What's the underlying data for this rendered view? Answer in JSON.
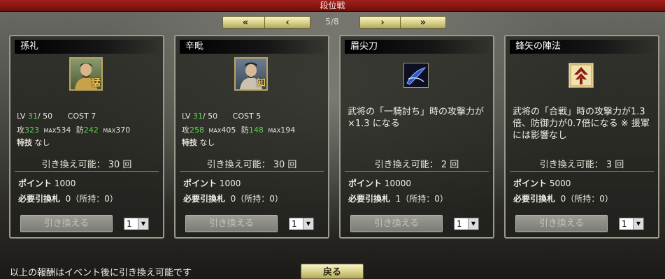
{
  "window": {
    "title": "段位戦"
  },
  "pager": {
    "first_label": "«",
    "prev_label": "‹",
    "next_label": "›",
    "last_label": "»",
    "indicator": "5/8"
  },
  "cards": [
    {
      "title": "孫礼",
      "kind": "general",
      "badge": "猛",
      "lv_label": "LV",
      "lv": "31",
      "lv_max": "/ 50",
      "cost_label": "COST",
      "cost": "7",
      "atk_label": "攻",
      "atk": "323",
      "atk_max_label": "MAX",
      "atk_max": "534",
      "def_label": "防",
      "def": "242",
      "def_max_label": "MAX",
      "def_max": "370",
      "skill_label": "特技",
      "skill": "なし",
      "remain": "引き換え可能： 30 回",
      "points_label": "ポイント",
      "points": "1000",
      "req_label": "必要引換札",
      "req": "0（所持：0）",
      "button": "引き換える",
      "qty": "1"
    },
    {
      "title": "辛毗",
      "kind": "general",
      "badge": "知",
      "lv_label": "LV",
      "lv": "31",
      "lv_max": "/ 50",
      "cost_label": "COST",
      "cost": "5",
      "atk_label": "攻",
      "atk": "258",
      "atk_max_label": "MAX",
      "atk_max": "405",
      "def_label": "防",
      "def": "148",
      "def_max_label": "MAX",
      "def_max": "194",
      "skill_label": "特技",
      "skill": "なし",
      "remain": "引き換え可能： 30 回",
      "points_label": "ポイント",
      "points": "1000",
      "req_label": "必要引換札",
      "req": "0（所持：0）",
      "button": "引き換える",
      "qty": "1"
    },
    {
      "title": "眉尖刀",
      "kind": "item",
      "icon": "blade-icon",
      "desc": "武将の「一騎討ち」時の攻撃力が ×1.3 になる",
      "remain": "引き換え可能： 2 回",
      "points_label": "ポイント",
      "points": "10000",
      "req_label": "必要引換札",
      "req": "1（所持：0）",
      "button": "引き換える",
      "qty": "1"
    },
    {
      "title": "鋒矢の陣法",
      "kind": "item",
      "icon": "arrow-formation-icon",
      "desc": "武将の「合戦」時の攻撃力が1.3倍、防御力が0.7倍になる ※ 援軍には影響なし",
      "remain": "引き換え可能： 3 回",
      "points_label": "ポイント",
      "points": "5000",
      "req_label": "必要引換札",
      "req": "0（所持：0）",
      "button": "引き換える",
      "qty": "1"
    }
  ],
  "footer": {
    "note": "以上の報酬はイベント後に引き換え可能です",
    "back_label": "戻る"
  },
  "colors": {
    "title_bar": "#8e1814",
    "button_gold": "#d7cf88",
    "stat_green": "#58d84a"
  }
}
